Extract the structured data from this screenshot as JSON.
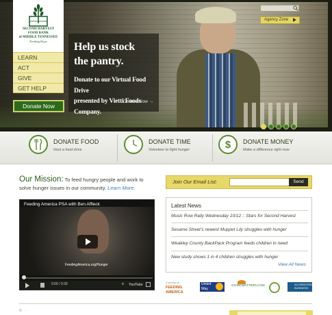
{
  "brand": {
    "logo_lines": [
      "SECOND HARVEST",
      "FOOD BANK",
      "of MIDDLE TENNESSEE"
    ],
    "tagline": "Feeding Hope",
    "accent": "#2e6a1c",
    "gold": "#e7d869"
  },
  "nav": {
    "items": [
      "LEARN",
      "ACT",
      "GIVE",
      "GET HELP"
    ],
    "donate_button": "Donate Now"
  },
  "hero": {
    "headline_line1": "Help us stock",
    "headline_line2": "the pantry.",
    "sub_line1": "Donate to our Virtual Food Drive",
    "sub_line2": "presented by Vietti Foods",
    "sub_line3": "Company.",
    "link": "Donate Now →",
    "search_icon": "search-icon",
    "agency_zone": "Agency Zone",
    "slides": 5,
    "active_slide": 1
  },
  "services": [
    {
      "title": "DONATE FOOD",
      "subtitle": "Host a food drive",
      "icon": "food-bowl-icon"
    },
    {
      "title": "DONATE TIME",
      "subtitle": "Volunteer to fight hunger",
      "icon": "clock-icon"
    },
    {
      "title": "DONATE MONEY",
      "subtitle": "Make a difference right now",
      "icon": "dollar-icon"
    }
  ],
  "mission": {
    "heading": "Our Mission:",
    "text": " To feed hungry people and work to solve hunger issues in our community. ",
    "link": "Learn More."
  },
  "video": {
    "title": "Feeding America PSA with Ben Affleck",
    "site": "FeedingAmerica.org/Hunger",
    "time": "0:00 / 0:30",
    "yt": "YouTube"
  },
  "email": {
    "label": "Join Our Email List:",
    "placeholder": "",
    "send": "Send"
  },
  "news": {
    "title": "Latest News",
    "items": [
      "Music Row Rally Wednesday 10/12 :: Stars for Second Harvest",
      "Sesame Street’s newest Muppet Lily struggles with hunger",
      "Weakley County BackPack Program feeds children in need",
      "New study shows 1 in 4 children struggles with hunger"
    ],
    "more": "View All News"
  },
  "partners": {
    "feeding_america": [
      "A member of",
      "FEEDING",
      "AMERICA"
    ],
    "united_way": [
      "United",
      "Way"
    ],
    "giving_matters": "GIVINGMATTERS.COM",
    "bbb": [
      "ACCREDITED",
      "BUSINESS"
    ]
  },
  "footer": {
    "text": "© · · ·"
  }
}
